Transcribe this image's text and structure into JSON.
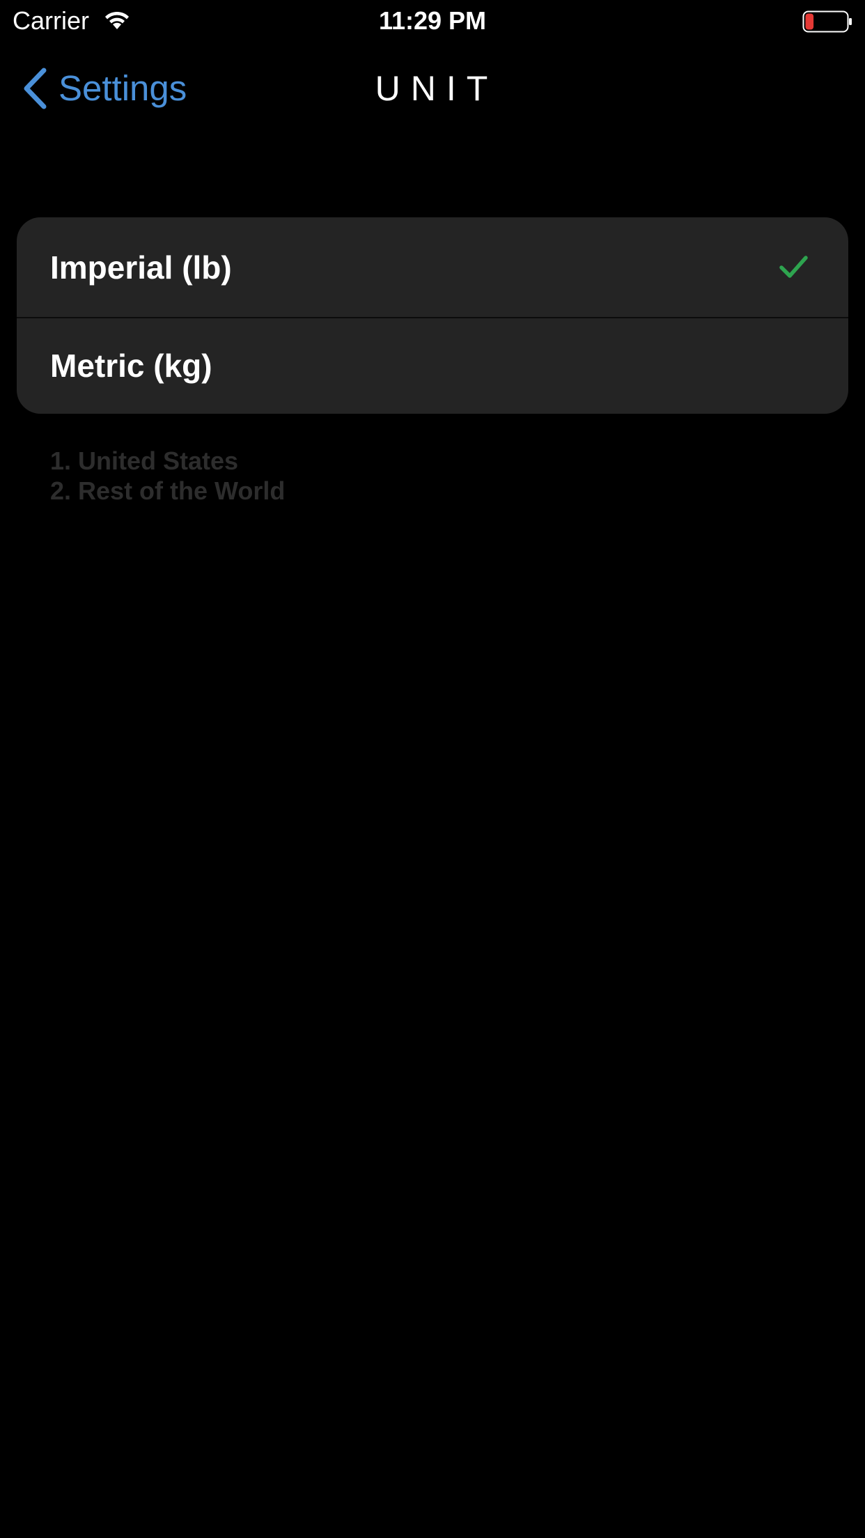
{
  "status_bar": {
    "carrier": "Carrier",
    "time": "11:29 PM",
    "battery_level": 0.2,
    "battery_color": "#e53935",
    "wifi_icon": "wifi-icon"
  },
  "nav": {
    "back_label": "Settings",
    "back_icon": "chevron-left-icon",
    "title": "UNIT",
    "accent_color": "#4a90d9"
  },
  "options": [
    {
      "label": "Imperial (lb)",
      "selected": true
    },
    {
      "label": "Metric (kg)",
      "selected": false
    }
  ],
  "check_color": "#2ea44f",
  "footnote": {
    "lines": [
      "1. United States",
      "2. Rest of the World"
    ]
  }
}
